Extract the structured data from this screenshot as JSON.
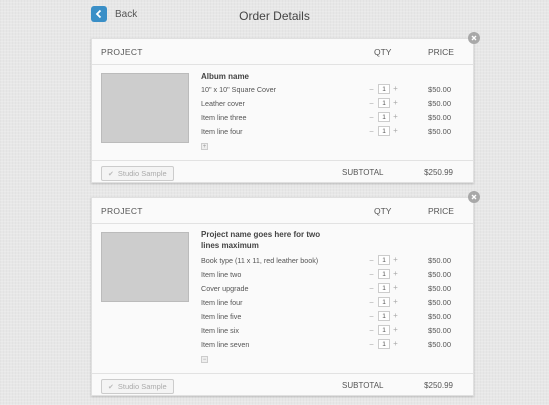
{
  "header": {
    "back_label": "Back",
    "title": "Order Details"
  },
  "columns": {
    "project": "PROJECT",
    "qty": "QTY",
    "price": "PRICE"
  },
  "orders": [
    {
      "name": "Album name",
      "lines": [
        {
          "label": "10\" x 10\" Square Cover",
          "qty": "1",
          "price": "$50.00"
        },
        {
          "label": "Leather cover",
          "qty": "1",
          "price": "$50.00"
        },
        {
          "label": "Item line three",
          "qty": "1",
          "price": "$50.00"
        },
        {
          "label": "Item line four",
          "qty": "1",
          "price": "$50.00"
        }
      ],
      "add_symbol": "+",
      "studio_sample_label": "Studio Sample",
      "subtotal_label": "SUBTOTAL",
      "subtotal_value": "$250.99"
    },
    {
      "name": "Project name goes here for two lines maximum",
      "lines": [
        {
          "label": "Book type (11 x 11, red leather book)",
          "qty": "1",
          "price": "$50.00"
        },
        {
          "label": "Item line two",
          "qty": "1",
          "price": "$50.00"
        },
        {
          "label": "Cover upgrade",
          "qty": "1",
          "price": "$50.00"
        },
        {
          "label": "Item line four",
          "qty": "1",
          "price": "$50.00"
        },
        {
          "label": "Item line five",
          "qty": "1",
          "price": "$50.00"
        },
        {
          "label": "Item line six",
          "qty": "1",
          "price": "$50.00"
        },
        {
          "label": "Item line seven",
          "qty": "1",
          "price": "$50.00"
        }
      ],
      "add_symbol": "−",
      "studio_sample_label": "Studio Sample",
      "subtotal_label": "SUBTOTAL",
      "subtotal_value": "$250.99"
    }
  ],
  "icons": {
    "back": "chevron-left-icon",
    "close": "close-icon",
    "check": "check-icon"
  },
  "colors": {
    "accent": "#3a8fc7",
    "thumbnail": "#cdcdcd"
  }
}
